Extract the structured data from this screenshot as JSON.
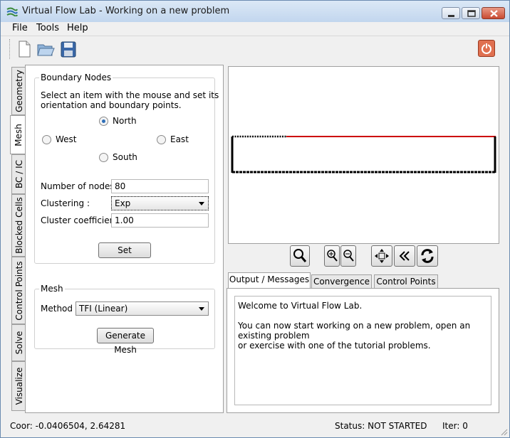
{
  "window": {
    "title": "Virtual Flow Lab - Working on a new problem"
  },
  "menu": [
    "File",
    "Tools",
    "Help"
  ],
  "toolbar": {
    "icons": [
      "new-file-icon",
      "open-folder-icon",
      "save-disk-icon",
      "power-icon"
    ]
  },
  "side_tabs": [
    "Geometry",
    "Mesh",
    "BC / IC",
    "Blocked Cells",
    "Control Points",
    "Solve",
    "Visualize"
  ],
  "boundary_nodes": {
    "title": "Boundary Nodes",
    "instruction_line1": "Select an item with the mouse and set its",
    "instruction_line2": "orientation and boundary points.",
    "options": {
      "north": "North",
      "west": "West",
      "east": "East",
      "south": "South"
    },
    "selected": "North",
    "num_nodes_label": "Number of nodes :",
    "num_nodes_value": "80",
    "clustering_label": "Clustering :",
    "clustering_value": "Exp",
    "cluster_coeff_label": "Cluster coefficient :",
    "cluster_coeff_value": "1.00",
    "set_button": "Set"
  },
  "mesh": {
    "title": "Mesh",
    "method_label": "Method :",
    "method_value": "TFI (Linear)",
    "generate_button": "Generate Mesh"
  },
  "canvas": {
    "highlight_color": "#cc0000",
    "boundary_color": "#000000"
  },
  "view_controls": [
    "zoom-icon",
    "zoom-in-icon",
    "zoom-out-icon",
    "pan-icon",
    "rewind-icon",
    "refresh-icon"
  ],
  "output_tabs": [
    "Output / Messages",
    "Convergence",
    "Control Points"
  ],
  "messages": {
    "line1": "Welcome to Virtual Flow Lab.",
    "line2": "You can now start working on a new problem, open an existing problem",
    "line3": "or exercise with one of the tutorial problems."
  },
  "status": {
    "coords": "Coor: -0.0406504, 2.64281",
    "status": "Status: NOT STARTED",
    "iter": "Iter: 0"
  }
}
